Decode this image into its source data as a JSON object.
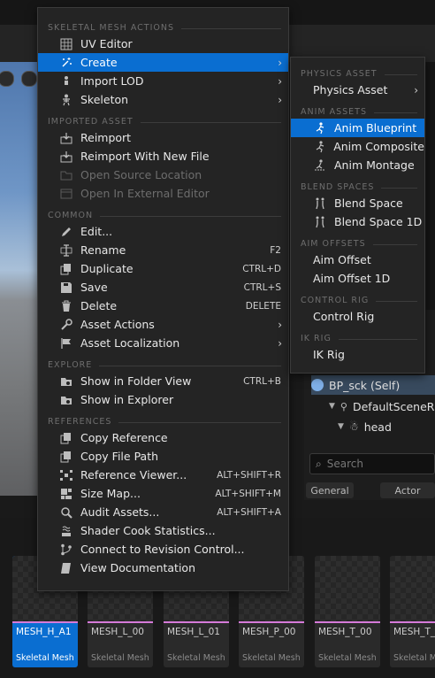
{
  "main_menu": {
    "sections": [
      {
        "title": "SKELETAL MESH ACTIONS",
        "items": [
          {
            "label": "UV Editor",
            "icon": "uv-grid-icon"
          },
          {
            "label": "Create",
            "icon": "create-sparkle-icon",
            "submenu": true,
            "highlighted": true
          },
          {
            "label": "Import LOD",
            "icon": "import-lod-icon",
            "submenu": true
          },
          {
            "label": "Skeleton",
            "icon": "skeleton-icon",
            "submenu": true
          }
        ]
      },
      {
        "title": "IMPORTED ASSET",
        "items": [
          {
            "label": "Reimport",
            "icon": "reimport-icon"
          },
          {
            "label": "Reimport With New File",
            "icon": "reimport-file-icon"
          },
          {
            "label": "Open Source Location",
            "icon": "folder-source-icon",
            "disabled": true
          },
          {
            "label": "Open In External Editor",
            "icon": "external-editor-icon",
            "disabled": true
          }
        ]
      },
      {
        "title": "COMMON",
        "items": [
          {
            "label": "Edit...",
            "icon": "pencil-icon"
          },
          {
            "label": "Rename",
            "icon": "rename-icon",
            "shortcut": "F2"
          },
          {
            "label": "Duplicate",
            "icon": "duplicate-icon",
            "shortcut": "CTRL+D"
          },
          {
            "label": "Save",
            "icon": "save-icon",
            "shortcut": "CTRL+S"
          },
          {
            "label": "Delete",
            "icon": "trash-icon",
            "shortcut": "DELETE"
          },
          {
            "label": "Asset Actions",
            "icon": "wrench-icon",
            "submenu": true
          },
          {
            "label": "Asset Localization",
            "icon": "flag-icon",
            "submenu": true
          }
        ]
      },
      {
        "title": "EXPLORE",
        "items": [
          {
            "label": "Show in Folder View",
            "icon": "folder-search-icon",
            "shortcut": "CTRL+B"
          },
          {
            "label": "Show in Explorer",
            "icon": "explorer-search-icon"
          }
        ]
      },
      {
        "title": "REFERENCES",
        "items": [
          {
            "label": "Copy Reference",
            "icon": "copy-reference-icon"
          },
          {
            "label": "Copy File Path",
            "icon": "copy-path-icon"
          },
          {
            "label": "Reference Viewer...",
            "icon": "reference-viewer-icon",
            "shortcut": "ALT+SHIFT+R"
          },
          {
            "label": "Size Map...",
            "icon": "size-map-icon",
            "shortcut": "ALT+SHIFT+M"
          },
          {
            "label": "Audit Assets...",
            "icon": "audit-icon",
            "shortcut": "ALT+SHIFT+A"
          },
          {
            "label": "Shader Cook Statistics...",
            "icon": "shader-stats-icon"
          },
          {
            "label": "Connect to Revision Control...",
            "icon": "revision-control-icon"
          },
          {
            "label": "View Documentation",
            "icon": "documentation-icon"
          }
        ]
      }
    ]
  },
  "create_submenu": {
    "sections": [
      {
        "title": "PHYSICS ASSET",
        "items": [
          {
            "label": "Physics Asset",
            "submenu": true
          }
        ]
      },
      {
        "title": "ANIM ASSETS",
        "items": [
          {
            "label": "Anim Blueprint",
            "icon": "anim-blueprint-icon",
            "highlighted": true
          },
          {
            "label": "Anim Composite",
            "icon": "anim-composite-icon"
          },
          {
            "label": "Anim Montage",
            "icon": "anim-montage-icon"
          }
        ]
      },
      {
        "title": "BLEND SPACES",
        "items": [
          {
            "label": "Blend Space",
            "icon": "blend-space-icon"
          },
          {
            "label": "Blend Space 1D",
            "icon": "blend-space-1d-icon"
          }
        ]
      },
      {
        "title": "AIM OFFSETS",
        "items": [
          {
            "label": "Aim Offset"
          },
          {
            "label": "Aim Offset 1D"
          }
        ]
      },
      {
        "title": "CONTROL RIG",
        "items": [
          {
            "label": "Control Rig"
          }
        ]
      },
      {
        "title": "IK RIG",
        "items": [
          {
            "label": "IK Rig"
          }
        ]
      }
    ]
  },
  "components": {
    "root": "BP_sck (Self)",
    "scene_root": "DefaultSceneR",
    "head": "head",
    "search_placeholder": "Search",
    "tab_general": "General",
    "tab_actor": "Actor"
  },
  "assets": [
    {
      "name": "MESH_H_A1",
      "type": "Skeletal Mesh",
      "selected": true
    },
    {
      "name": "MESH_L_00",
      "type": "Skeletal Mesh"
    },
    {
      "name": "MESH_L_01",
      "type": "Skeletal Mesh"
    },
    {
      "name": "MESH_P_00",
      "type": "Skeletal Mesh"
    },
    {
      "name": "MESH_T_00",
      "type": "Skeletal Mesh"
    },
    {
      "name": "MESH_T_",
      "type": "Skeletal Mesh"
    }
  ],
  "colors": {
    "highlight": "#0a6ed1",
    "asset_bar": "#d57ad9"
  }
}
